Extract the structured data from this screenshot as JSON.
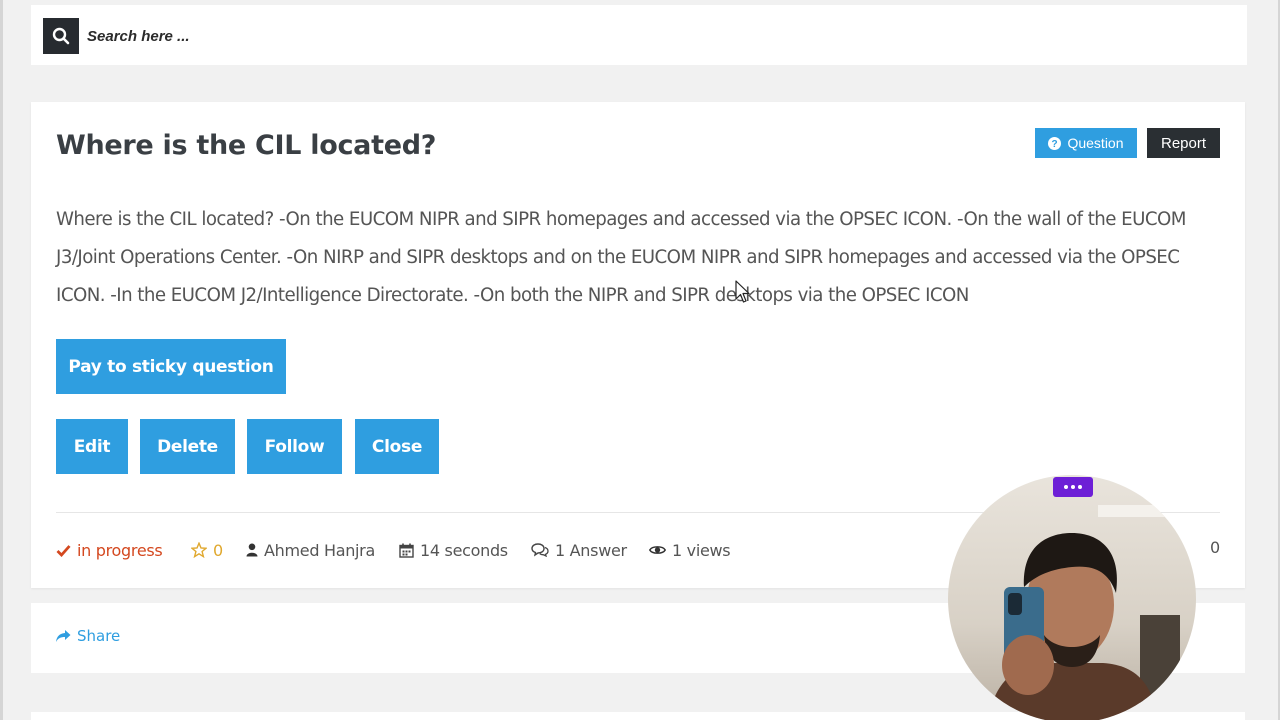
{
  "search": {
    "placeholder": "Search here ...",
    "icon": "search-icon"
  },
  "question": {
    "title": "Where is the CIL located?",
    "badge_label": "Question",
    "report_label": "Report",
    "body": "Where is the CIL located? -On the EUCOM NIPR and SIPR homepages and accessed via the OPSEC ICON. -On the wall of the EUCOM J3/Joint Operations Center. -On NIRP and SIPR desktops and on the EUCOM NIPR and SIPR homepages and accessed via the OPSEC ICON. -In the EUCOM J2/Intelligence Directorate. -On both the NIPR and SIPR desktops via the OPSEC ICON"
  },
  "actions": {
    "sticky_label": "Pay to sticky question",
    "edit_label": "Edit",
    "delete_label": "Delete",
    "follow_label": "Follow",
    "close_label": "Close"
  },
  "meta": {
    "status": "in progress",
    "votes": "0",
    "author": "Ahmed Hanjra",
    "time": "14 seconds",
    "answers": "1 Answer",
    "views": "1 views",
    "right_count": "0"
  },
  "share": {
    "label": "Share"
  },
  "colors": {
    "accent": "#2f9ee0",
    "dark": "#272b30",
    "status": "#d4481f",
    "star": "#e0a82e",
    "overlay_pill": "#6d1fd6"
  }
}
